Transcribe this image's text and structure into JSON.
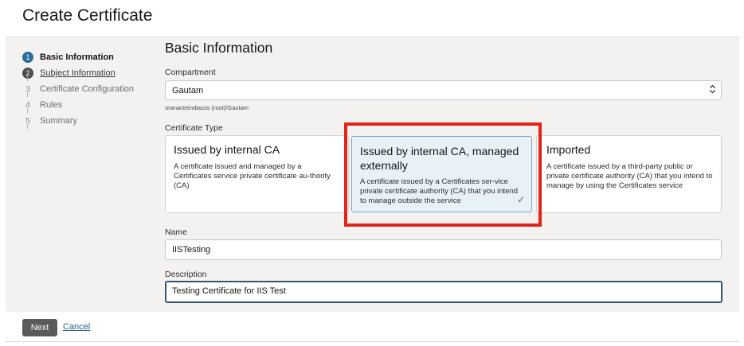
{
  "page": {
    "title": "Create Certificate"
  },
  "steps": [
    {
      "number": "1",
      "label": "Basic Information",
      "state": "active"
    },
    {
      "number": "2",
      "label": "Subject Information",
      "state": "done"
    },
    {
      "number": "3",
      "label": "Certificate Configuration",
      "state": "pending"
    },
    {
      "number": "4",
      "label": "Rules",
      "state": "pending"
    },
    {
      "number": "5",
      "label": "Summary",
      "state": "pending"
    }
  ],
  "section": {
    "title": "Basic Information"
  },
  "compartment": {
    "label": "Compartment",
    "value": "Gautam",
    "helper": "oranacteindiasss (root)/Gautam"
  },
  "certificate_type": {
    "label": "Certificate Type",
    "options": [
      {
        "title": "Issued by internal CA",
        "description": "A certificate issued and managed by a Certificates service private certificate au-thority (CA)"
      },
      {
        "title": "Issued by internal CA, managed externally",
        "description": "A certificate issued by a Certificates ser-vice private certificate authority (CA) that you intend to manage outside the service",
        "selected": true
      },
      {
        "title": "Imported",
        "description": "A certificate issued by a third-party public or private certificate authority (CA) that you intend to manage by using the Certificates service"
      }
    ],
    "selected_check": "✓"
  },
  "name": {
    "label": "Name",
    "value": "IISTesting"
  },
  "description": {
    "label": "Description",
    "value": "Testing Certificate for IIS Test"
  },
  "footer": {
    "next_label": "Next",
    "cancel_label": "Cancel"
  },
  "colors": {
    "accent": "#2c6e99",
    "highlight": "#e2231a",
    "selected_card_bg": "#e8f1f6"
  },
  "icons": {
    "select_chevron": "chevron-up-down-icon",
    "selected_check": "check-icon"
  }
}
